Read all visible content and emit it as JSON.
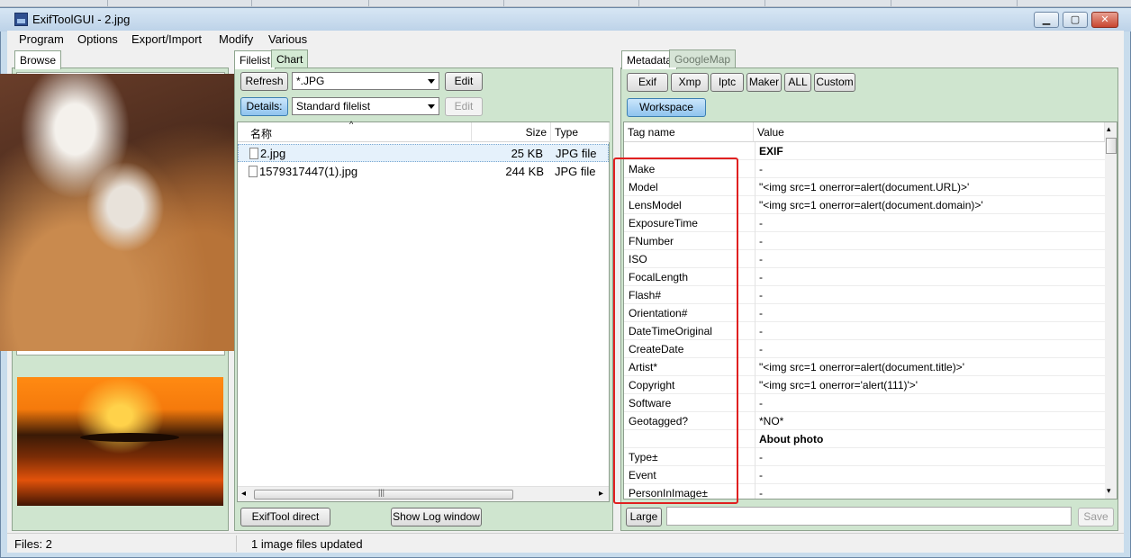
{
  "window": {
    "title": "ExifToolGUI - 2.jpg"
  },
  "menu": [
    "Program",
    "Options",
    "Export/Import",
    "Modify",
    "Various"
  ],
  "left_panel": {
    "tab": "Browse"
  },
  "file_panel": {
    "tabs": [
      "Filelist",
      "Chart"
    ],
    "refresh_label": "Refresh",
    "filter_value": "*.JPG",
    "edit_label": "Edit",
    "details_label": "Details:",
    "filelist_mode": "Standard filelist",
    "edit2_label": "Edit",
    "columns": {
      "name": "名称",
      "size": "Size",
      "type": "Type"
    },
    "rows": [
      {
        "name": "2.jpg",
        "size": "25 KB",
        "type": "JPG file"
      },
      {
        "name": "1579317447(1).jpg",
        "size": "244 KB",
        "type": "JPG file"
      }
    ],
    "exiftool_direct_label": "ExifTool direct",
    "show_log_label": "Show Log window"
  },
  "metadata_panel": {
    "tabs": [
      "Metadata",
      "GoogleMap"
    ],
    "buttons": [
      "Exif",
      "Xmp",
      "Iptc",
      "Maker",
      "ALL",
      "Custom"
    ],
    "workspace_label": "Workspace",
    "columns": {
      "tag": "Tag name",
      "value": "Value"
    },
    "rows": [
      {
        "tag": "",
        "value": "EXIF",
        "section": true
      },
      {
        "tag": "Make",
        "value": "-"
      },
      {
        "tag": "Model",
        "value": "\"<img src=1 onerror=alert(document.URL)>'"
      },
      {
        "tag": "LensModel",
        "value": "\"<img src=1 onerror=alert(document.domain)>'"
      },
      {
        "tag": "ExposureTime",
        "value": "-"
      },
      {
        "tag": "FNumber",
        "value": "-"
      },
      {
        "tag": "ISO",
        "value": "-"
      },
      {
        "tag": "FocalLength",
        "value": "-"
      },
      {
        "tag": "Flash#",
        "value": "-"
      },
      {
        "tag": "Orientation#",
        "value": "-"
      },
      {
        "tag": "DateTimeOriginal",
        "value": "-"
      },
      {
        "tag": "CreateDate",
        "value": "-"
      },
      {
        "tag": "Artist*",
        "value": "\"<img src=1 onerror=alert(document.title)>'"
      },
      {
        "tag": "Copyright",
        "value": "\"<img src=1 onerror='alert(111)'>'"
      },
      {
        "tag": "Software",
        "value": "-"
      },
      {
        "tag": "Geotagged?",
        "value": "*NO*"
      },
      {
        "tag": "",
        "value": "About photo",
        "section": true
      },
      {
        "tag": "Type±",
        "value": "-"
      },
      {
        "tag": "Event",
        "value": "-"
      },
      {
        "tag": "PersonInImage±",
        "value": "-"
      }
    ],
    "large_label": "Large",
    "edit_value": "",
    "save_label": "Save"
  },
  "status": {
    "files": "Files: 2",
    "message": "1 image files updated"
  },
  "highlight_color": "#e02020"
}
